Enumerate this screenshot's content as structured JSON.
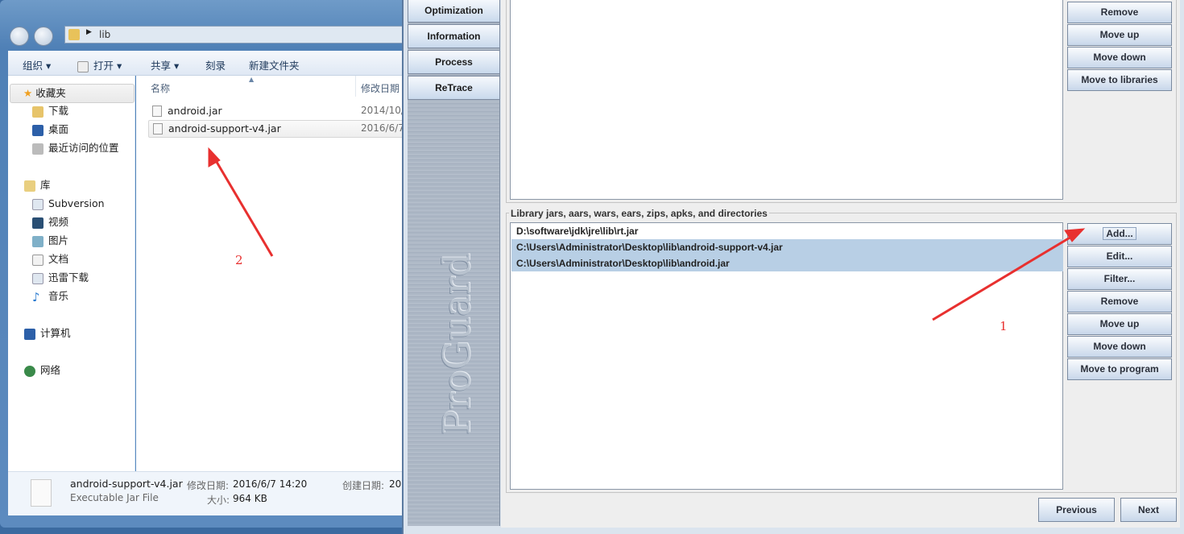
{
  "explorer": {
    "address": "lib",
    "toolbar": [
      "组织",
      "打开",
      "共享",
      "刻录",
      "新建文件夹"
    ],
    "nav": {
      "favorites": "收藏夹",
      "favorites_items": [
        "下载",
        "桌面",
        "最近访问的位置"
      ],
      "libraries": "库",
      "libraries_items": [
        "Subversion",
        "视频",
        "图片",
        "文档",
        "迅雷下载",
        "音乐"
      ],
      "computer": "计算机",
      "network": "网络"
    },
    "columns": {
      "name": "名称",
      "modified": "修改日期"
    },
    "files": [
      {
        "name": "android.jar",
        "modified": "2014/10/"
      },
      {
        "name": "android-support-v4.jar",
        "modified": "2016/6/7"
      }
    ],
    "details": {
      "name": "android-support-v4.jar",
      "type": "Executable Jar File",
      "modified_label": "修改日期:",
      "modified": "2016/6/7 14:20",
      "size_label": "大小:",
      "size": "964 KB",
      "created_label": "创建日期:",
      "created": "20"
    }
  },
  "proguard": {
    "logo": "ProGuard",
    "sidebar": [
      "Optimization",
      "Information",
      "Process",
      "ReTrace"
    ],
    "program_buttons": [
      "Remove",
      "Move up",
      "Move down",
      "Move to libraries"
    ],
    "library_group_title": "Library jars, aars, wars, ears, zips, apks, and directories",
    "library_entries": [
      {
        "path": "D:\\software\\jdk\\jre\\lib\\rt.jar",
        "selected": false
      },
      {
        "path": "C:\\Users\\Administrator\\Desktop\\lib\\android-support-v4.jar",
        "selected": true
      },
      {
        "path": "C:\\Users\\Administrator\\Desktop\\lib\\android.jar",
        "selected": true
      }
    ],
    "library_buttons": [
      "Add...",
      "Edit...",
      "Filter...",
      "Remove",
      "Move up",
      "Move down",
      "Move to program"
    ],
    "previous": "Previous",
    "next": "Next"
  },
  "annotations": {
    "label1": "1",
    "label2": "2",
    "color": "#e8302f"
  }
}
